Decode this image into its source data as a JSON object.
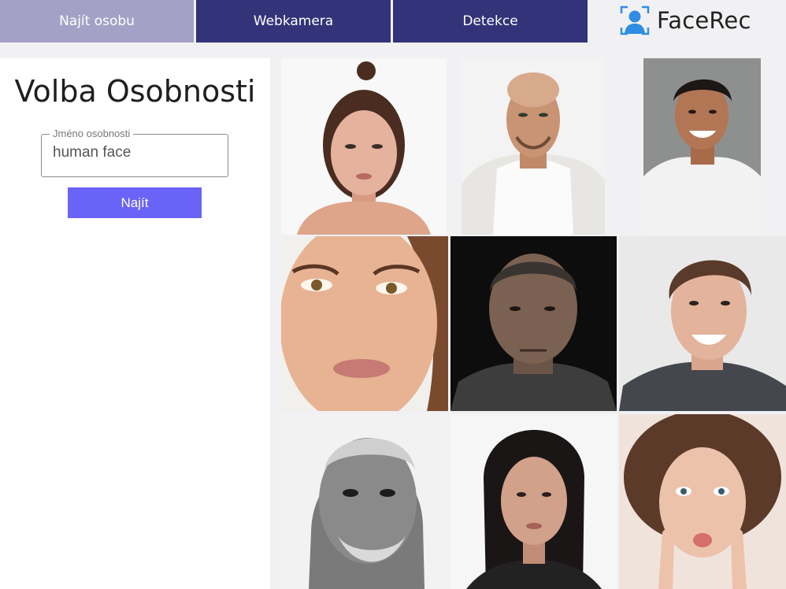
{
  "nav": {
    "tabs": [
      {
        "label": "Najít osobu",
        "active": true
      },
      {
        "label": "Webkamera",
        "active": false
      },
      {
        "label": "Detekce",
        "active": false
      }
    ]
  },
  "brand": {
    "name": "FaceRec",
    "icon": "face-recognition-icon",
    "color": "#2f8de4"
  },
  "panel": {
    "title": "Volba Osobnosti",
    "field_label": "Jméno osobnosti",
    "field_value": "human face",
    "button_label": "Najít"
  },
  "colors": {
    "accent": "#6a63f7",
    "nav_active": "#a3a1c6",
    "nav_inactive": "#33337a"
  },
  "gallery": [
    {
      "name": "woman-hair-bun-portrait"
    },
    {
      "name": "bald-man-tank-top-portrait"
    },
    {
      "name": "smiling-man-white-tshirt-portrait"
    },
    {
      "name": "young-woman-closeup-portrait"
    },
    {
      "name": "older-man-dark-background-portrait"
    },
    {
      "name": "smiling-young-man-portrait"
    },
    {
      "name": "elderly-bearded-man-bw-portrait"
    },
    {
      "name": "dark-haired-woman-portrait"
    },
    {
      "name": "surprised-curly-woman-portrait"
    }
  ]
}
